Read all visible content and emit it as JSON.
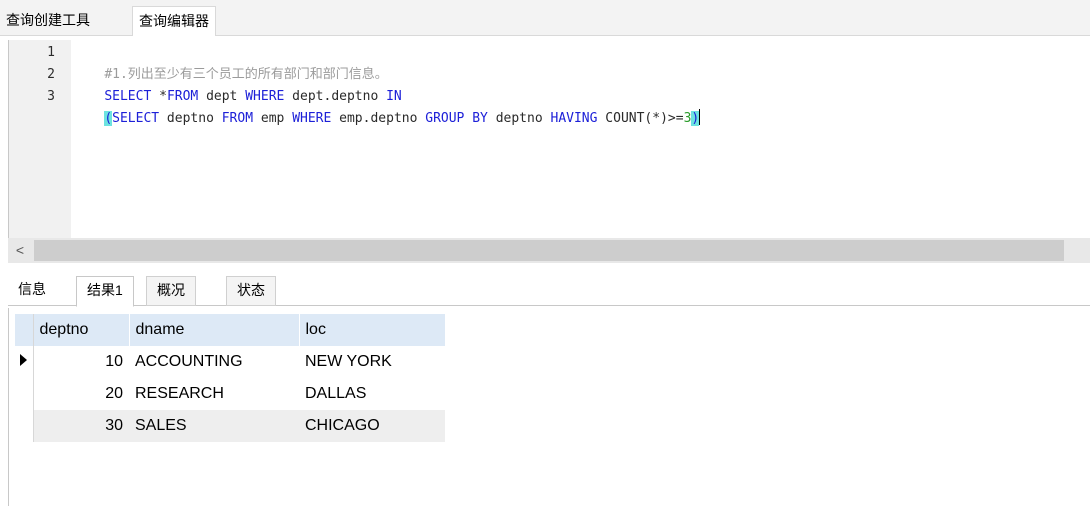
{
  "tabs": {
    "builder": "查询创建工具",
    "editor": "查询编辑器"
  },
  "editor": {
    "lines": [
      {
        "no": "1",
        "segments": [
          {
            "t": "#1.列出至少有三个员工的所有部门和部门信息。",
            "k": "comment"
          }
        ]
      },
      {
        "no": "2",
        "segments": [
          {
            "t": "SELECT",
            "k": "kw"
          },
          {
            "t": " *",
            "k": "id"
          },
          {
            "t": "FROM",
            "k": "kw"
          },
          {
            "t": " dept ",
            "k": "id"
          },
          {
            "t": "WHERE",
            "k": "kw"
          },
          {
            "t": " dept.deptno ",
            "k": "id"
          },
          {
            "t": "IN",
            "k": "kw"
          }
        ]
      },
      {
        "no": "3",
        "segments": [
          {
            "t": "(",
            "k": "paren"
          },
          {
            "t": "SELECT",
            "k": "kw"
          },
          {
            "t": " deptno ",
            "k": "id"
          },
          {
            "t": "FROM",
            "k": "kw"
          },
          {
            "t": " emp ",
            "k": "id"
          },
          {
            "t": "WHERE",
            "k": "kw"
          },
          {
            "t": " emp.deptno ",
            "k": "id"
          },
          {
            "t": "GROUP BY",
            "k": "kw"
          },
          {
            "t": " deptno ",
            "k": "id"
          },
          {
            "t": "HAVING",
            "k": "kw"
          },
          {
            "t": " COUNT(*)>=",
            "k": "id"
          },
          {
            "t": "3",
            "k": "num"
          },
          {
            "t": ")",
            "k": "paren"
          }
        ]
      }
    ]
  },
  "scrollbar": {
    "left_arrow": "<"
  },
  "result_tabs": {
    "info": "信息",
    "result1": "结果1",
    "overview": "概况",
    "status": "状态"
  },
  "grid": {
    "columns": [
      "deptno",
      "dname",
      "loc"
    ],
    "rows": [
      {
        "deptno": "10",
        "dname": "ACCOUNTING",
        "loc": "NEW YORK"
      },
      {
        "deptno": "20",
        "dname": "RESEARCH",
        "loc": "DALLAS"
      },
      {
        "deptno": "30",
        "dname": "SALES",
        "loc": "CHICAGO"
      }
    ]
  }
}
